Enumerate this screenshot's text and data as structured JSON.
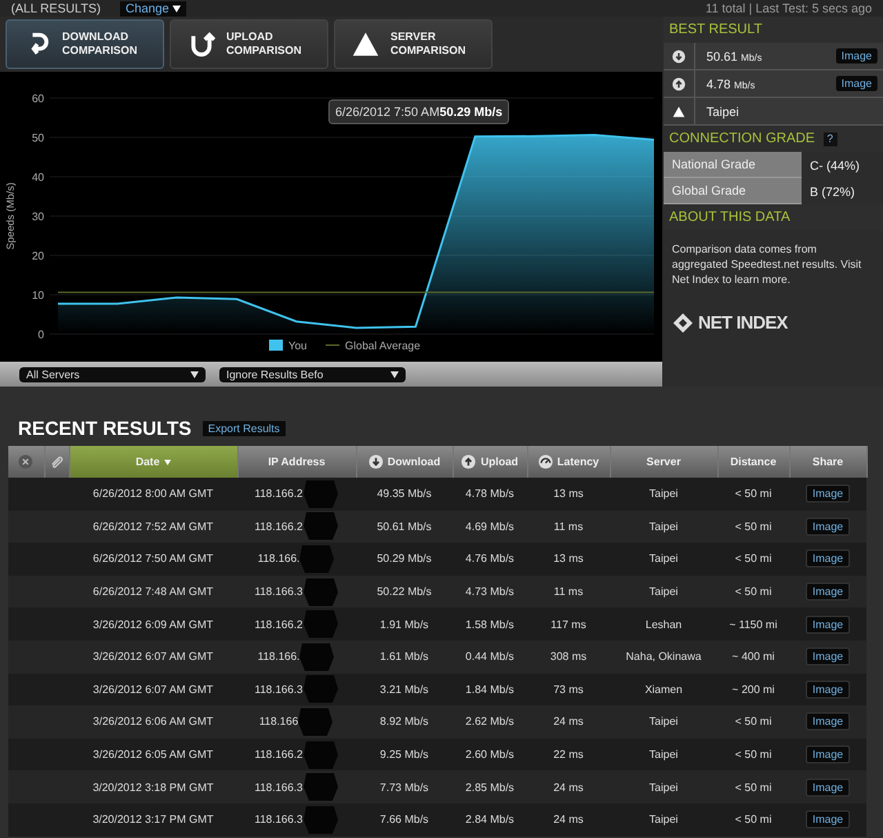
{
  "top_bar": {
    "label": "(ALL RESULTS)",
    "change_button": "Change",
    "status": "11 total | Last Test: 5 secs ago"
  },
  "comparison_tabs": [
    {
      "kind": "download",
      "label": "DOWNLOAD\nCOMPARISON",
      "selected": true
    },
    {
      "kind": "upload",
      "label": "UPLOAD\nCOMPARISON",
      "selected": false
    },
    {
      "kind": "server",
      "label": "SERVER\nCOMPARISON",
      "selected": false
    }
  ],
  "chart": {
    "tooltip": "6/26/2012 7:50 AM**50.29 Mb/s**",
    "chart_data": {
      "type": "area",
      "ylabel": "Speeds (Mb/s)",
      "grid": true,
      "legend": true,
      "ylim": [
        0,
        60
      ],
      "yticks": [
        0,
        10,
        20,
        30,
        40,
        50,
        60
      ],
      "series": [
        {
          "name": "You",
          "color": "#3fc3ee",
          "values": [
            7.7,
            7.7,
            9.3,
            8.9,
            3.2,
            1.6,
            1.9,
            50.2,
            50.3,
            50.6,
            49.4
          ]
        },
        {
          "name": "Global Average",
          "type": "line",
          "color": "#5a6a2a",
          "values": [
            10.6,
            10.6,
            10.6,
            10.6,
            10.6,
            10.6,
            10.6,
            10.6,
            10.6,
            10.6,
            10.6
          ]
        }
      ]
    }
  },
  "filters": [
    {
      "value": "All Servers"
    },
    {
      "value": "Ignore Results Befo"
    }
  ],
  "best_result": {
    "title": "BEST RESULT",
    "items": [
      {
        "kind": "download",
        "value": "50.61",
        "unit": "Mb/s",
        "button": "Image"
      },
      {
        "kind": "upload",
        "value": "4.78",
        "unit": "Mb/s",
        "button": "Image"
      },
      {
        "kind": "server",
        "value": "Taipei"
      }
    ]
  },
  "connection_grade": {
    "title": "CONNECTION GRADE",
    "help": "?",
    "rows": [
      {
        "label": "National Grade",
        "value": "C- (44%)"
      },
      {
        "label": "Global Grade",
        "value": "B (72%)"
      }
    ]
  },
  "about": {
    "title": "ABOUT THIS DATA",
    "text": "Comparison data comes from aggregated Speedtest.net results. Visit Net Index to learn more.",
    "logo": "NET INDEX"
  },
  "recent_results": {
    "title": "RECENT RESULTS",
    "export_button": "Export Results",
    "columns": [
      {
        "kind": "close",
        "sorted": false
      },
      {
        "kind": "clip",
        "sorted": false
      },
      {
        "label": "Date",
        "kind": "text",
        "sorted": true
      },
      {
        "label": "IP Address",
        "kind": "text",
        "sorted": false
      },
      {
        "label": "Download",
        "kind": "download",
        "sorted": false
      },
      {
        "label": "Upload",
        "kind": "upload",
        "sorted": false
      },
      {
        "label": "Latency",
        "kind": "latency",
        "sorted": false
      },
      {
        "label": "Server",
        "kind": "text",
        "sorted": false
      },
      {
        "label": "Distance",
        "kind": "text",
        "sorted": false
      },
      {
        "label": "Share",
        "kind": "text",
        "sorted": false
      }
    ],
    "rows": [
      {
        "date": "6/26/2012 8:00 AM GMT",
        "ip": "118.166.2",
        "download": "49.35 Mb/s",
        "upload": "4.78 Mb/s",
        "latency": "13 ms",
        "server": "Taipei",
        "distance": "< 50 mi",
        "share": "Image"
      },
      {
        "date": "6/26/2012 7:52 AM GMT",
        "ip": "118.166.2",
        "download": "50.61 Mb/s",
        "upload": "4.69 Mb/s",
        "latency": "11 ms",
        "server": "Taipei",
        "distance": "< 50 mi",
        "share": "Image"
      },
      {
        "date": "6/26/2012 7:50 AM GMT",
        "ip": "118.166.",
        "download": "50.29 Mb/s",
        "upload": "4.76 Mb/s",
        "latency": "13 ms",
        "server": "Taipei",
        "distance": "< 50 mi",
        "share": "Image"
      },
      {
        "date": "6/26/2012 7:48 AM GMT",
        "ip": "118.166.3",
        "download": "50.22 Mb/s",
        "upload": "4.73 Mb/s",
        "latency": "11 ms",
        "server": "Taipei",
        "distance": "< 50 mi",
        "share": "Image"
      },
      {
        "date": "3/26/2012 6:09 AM GMT",
        "ip": "118.166.2",
        "download": "1.91 Mb/s",
        "upload": "1.58 Mb/s",
        "latency": "117 ms",
        "server": "Leshan",
        "distance": "~ 1150 mi",
        "share": "Image"
      },
      {
        "date": "3/26/2012 6:07 AM GMT",
        "ip": "118.166.",
        "download": "1.61 Mb/s",
        "upload": "0.44 Mb/s",
        "latency": "308 ms",
        "server": "Naha, Okinawa",
        "distance": "~ 400 mi",
        "share": "Image"
      },
      {
        "date": "3/26/2012 6:07 AM GMT",
        "ip": "118.166.3",
        "download": "3.21 Mb/s",
        "upload": "1.84 Mb/s",
        "latency": "73 ms",
        "server": "Xiamen",
        "distance": "~ 200 mi",
        "share": "Image"
      },
      {
        "date": "3/26/2012 6:06 AM GMT",
        "ip": "118.166",
        "download": "8.92 Mb/s",
        "upload": "2.62 Mb/s",
        "latency": "24 ms",
        "server": "Taipei",
        "distance": "< 50 mi",
        "share": "Image"
      },
      {
        "date": "3/26/2012 6:05 AM GMT",
        "ip": "118.166.2",
        "download": "9.25 Mb/s",
        "upload": "2.60 Mb/s",
        "latency": "22 ms",
        "server": "Taipei",
        "distance": "< 50 mi",
        "share": "Image"
      },
      {
        "date": "3/20/2012 3:18 PM GMT",
        "ip": "118.166.3",
        "download": "7.73 Mb/s",
        "upload": "2.85 Mb/s",
        "latency": "24 ms",
        "server": "Taipei",
        "distance": "< 50 mi",
        "share": "Image"
      },
      {
        "date": "3/20/2012 3:17 PM GMT",
        "ip": "118.166.3",
        "download": "7.66 Mb/s",
        "upload": "2.84 Mb/s",
        "latency": "24 ms",
        "server": "Taipei",
        "distance": "< 50 mi",
        "share": "Image"
      }
    ]
  }
}
